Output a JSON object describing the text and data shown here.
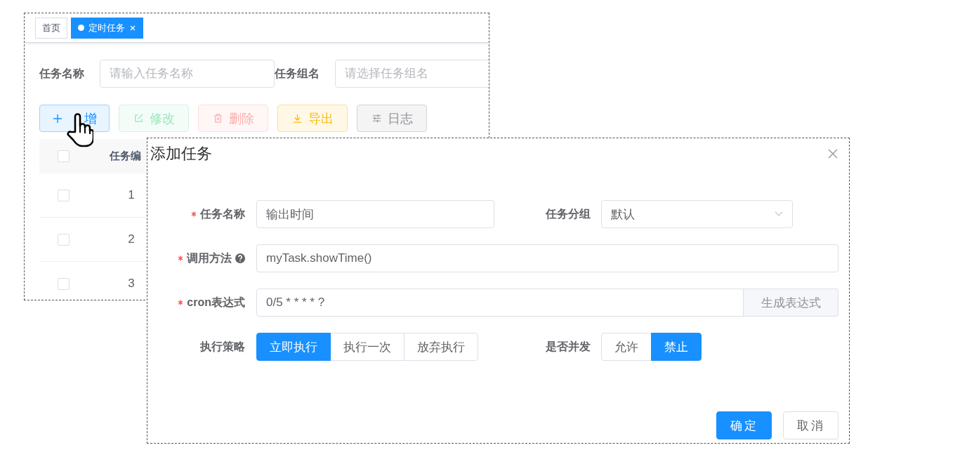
{
  "tabs": [
    {
      "label": "首页",
      "selected": false,
      "closable": false
    },
    {
      "label": "定时任务",
      "selected": true,
      "closable": true
    }
  ],
  "search": {
    "fields": [
      {
        "label": "任务名称",
        "placeholder": "请输入任务名称"
      },
      {
        "label": "任务组名",
        "placeholder": "请选择任务组名"
      }
    ]
  },
  "toolbar": [
    {
      "label": "增",
      "kind": "primary",
      "disabled": false
    },
    {
      "label": "修改",
      "kind": "success",
      "disabled": true
    },
    {
      "label": "删除",
      "kind": "danger",
      "disabled": true
    },
    {
      "label": "导出",
      "kind": "warning",
      "disabled": false
    },
    {
      "label": "日志",
      "kind": "info",
      "disabled": false
    }
  ],
  "table": {
    "header_checked": false,
    "columns": [
      "任务编"
    ],
    "rows": [
      {
        "checked": false,
        "cells": [
          "1"
        ]
      },
      {
        "checked": false,
        "cells": [
          "2"
        ]
      },
      {
        "checked": false,
        "cells": [
          "3"
        ]
      }
    ]
  },
  "dialog": {
    "title": "添加任务",
    "fields": [
      {
        "kind": "text",
        "label": "任务名称",
        "required": true,
        "value": "输出时间"
      },
      {
        "kind": "select",
        "label": "任务分组",
        "required": false,
        "value": "默认"
      },
      {
        "kind": "text",
        "label": "调用方法",
        "required": true,
        "help": true,
        "value": "myTask.showTime()"
      },
      {
        "kind": "append",
        "label": "cron表达式",
        "required": true,
        "value": "0/5 * * * * ?",
        "button": "生成表达式"
      },
      {
        "kind": "radio",
        "label": "执行策略",
        "required": false,
        "options": [
          {
            "label": "立即执行",
            "selected": true
          },
          {
            "label": "执行一次",
            "selected": false
          },
          {
            "label": "放弃执行",
            "selected": false
          }
        ]
      },
      {
        "kind": "radio",
        "label": "是否并发",
        "required": false,
        "options": [
          {
            "label": "允许",
            "selected": false
          },
          {
            "label": "禁止",
            "selected": true
          }
        ]
      }
    ],
    "footer": [
      {
        "label": "确定",
        "kind": "primary"
      },
      {
        "label": "取消",
        "kind": "default"
      }
    ]
  }
}
